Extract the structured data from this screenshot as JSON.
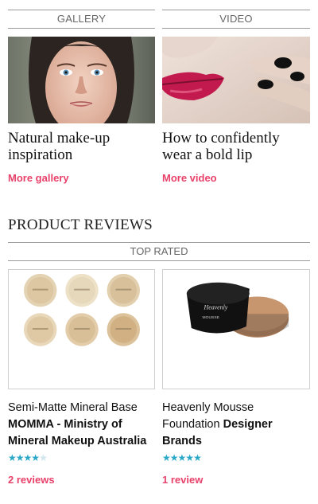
{
  "sections": {
    "gallery_label": "GALLERY",
    "video_label": "VIDEO"
  },
  "gallery_card": {
    "title": "Natural make-up inspiration",
    "link": "More gallery"
  },
  "video_card": {
    "title": "How to confidently wear a bold lip",
    "link": "More video"
  },
  "product_reviews": {
    "heading": "PRODUCT REVIEWS",
    "tab": "TOP RATED",
    "products": [
      {
        "name_prefix": "Semi-Matte Mineral Base ",
        "brand": "MOMMA - Ministry of Mineral Makeup Australia",
        "name_suffix": "",
        "rating": 4,
        "max_rating": 5,
        "reviews": "2 reviews",
        "image_icon": "mineral-powder-jars-image"
      },
      {
        "name_prefix": "Heavenly Mousse Foundation ",
        "brand": "Designer Brands",
        "name_suffix": "",
        "rating": 5,
        "max_rating": 5,
        "reviews": "1 review",
        "image_icon": "mousse-foundation-jar-image"
      }
    ]
  },
  "colors": {
    "accent_pink": "#e8416a",
    "star_blue": "#2aa8c6"
  }
}
